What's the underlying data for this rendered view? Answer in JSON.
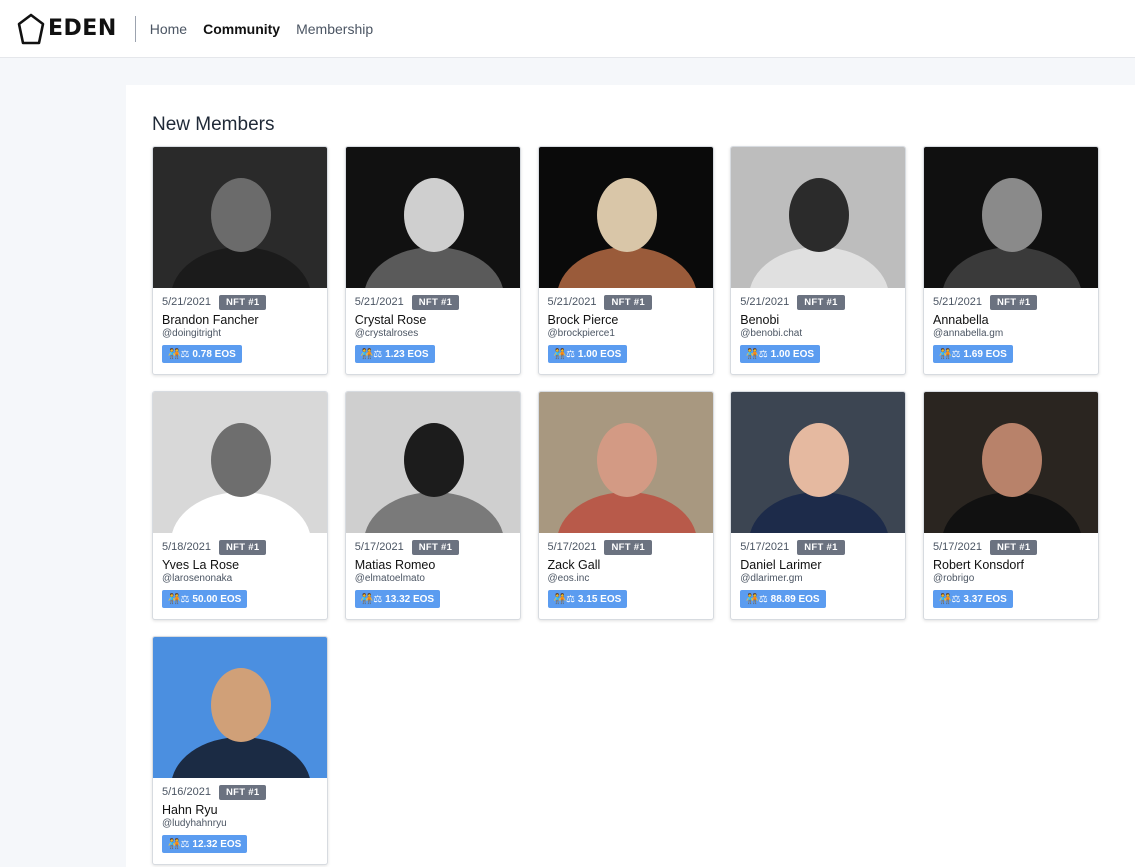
{
  "app": {
    "logo_text": "EDEN"
  },
  "nav": [
    {
      "label": "Home",
      "active": false
    },
    {
      "label": "Community",
      "active": true
    },
    {
      "label": "Membership",
      "active": false
    }
  ],
  "section": {
    "title": "New Members"
  },
  "eos_emoji": "🧑‍🤝‍🧑⚖",
  "members": [
    {
      "date": "5/21/2021",
      "nft": "NFT #1",
      "name": "Brandon Fancher",
      "handle": "@doingitright",
      "eos": "0.78 EOS",
      "photo_colors": [
        "#2a2a2a",
        "#6b6b6b",
        "#1b1b1b"
      ]
    },
    {
      "date": "5/21/2021",
      "nft": "NFT #1",
      "name": "Crystal Rose",
      "handle": "@crystalroses",
      "eos": "1.23 EOS",
      "photo_colors": [
        "#111111",
        "#cfcfcf",
        "#5a5a5a"
      ]
    },
    {
      "date": "5/21/2021",
      "nft": "NFT #1",
      "name": "Brock Pierce",
      "handle": "@brockpierce1",
      "eos": "1.00 EOS",
      "photo_colors": [
        "#0a0a0a",
        "#d9c6a8",
        "#9a5b3a"
      ]
    },
    {
      "date": "5/21/2021",
      "nft": "NFT #1",
      "name": "Benobi",
      "handle": "@benobi.chat",
      "eos": "1.00 EOS",
      "photo_colors": [
        "#bdbdbd",
        "#2b2b2b",
        "#e0e0e0"
      ]
    },
    {
      "date": "5/21/2021",
      "nft": "NFT #1",
      "name": "Annabella",
      "handle": "@annabella.gm",
      "eos": "1.69 EOS",
      "photo_colors": [
        "#101010",
        "#8a8a8a",
        "#3a3a3a"
      ]
    },
    {
      "date": "5/18/2021",
      "nft": "NFT #1",
      "name": "Yves La Rose",
      "handle": "@larosenonaka",
      "eos": "50.00 EOS",
      "photo_colors": [
        "#d8d8d8",
        "#6e6e6e",
        "#ffffff"
      ]
    },
    {
      "date": "5/17/2021",
      "nft": "NFT #1",
      "name": "Matias Romeo",
      "handle": "@elmatoelmato",
      "eos": "13.32 EOS",
      "photo_colors": [
        "#cfcfcf",
        "#1c1c1c",
        "#7a7a7a"
      ]
    },
    {
      "date": "5/17/2021",
      "nft": "NFT #1",
      "name": "Zack Gall",
      "handle": "@eos.inc",
      "eos": "3.15 EOS",
      "photo_colors": [
        "#a89880",
        "#d39a84",
        "#b85a4a"
      ]
    },
    {
      "date": "5/17/2021",
      "nft": "NFT #1",
      "name": "Daniel Larimer",
      "handle": "@dlarimer.gm",
      "eos": "88.89 EOS",
      "photo_colors": [
        "#3c4552",
        "#e5b9a0",
        "#1d2b4a"
      ]
    },
    {
      "date": "5/17/2021",
      "nft": "NFT #1",
      "name": "Robert Konsdorf",
      "handle": "@robrigo",
      "eos": "3.37 EOS",
      "photo_colors": [
        "#2a2520",
        "#b8826a",
        "#111111"
      ]
    },
    {
      "date": "5/16/2021",
      "nft": "NFT #1",
      "name": "Hahn Ryu",
      "handle": "@ludyhahnryu",
      "eos": "12.32 EOS",
      "photo_colors": [
        "#4b8fe0",
        "#d0a078",
        "#1b2b44"
      ]
    }
  ]
}
